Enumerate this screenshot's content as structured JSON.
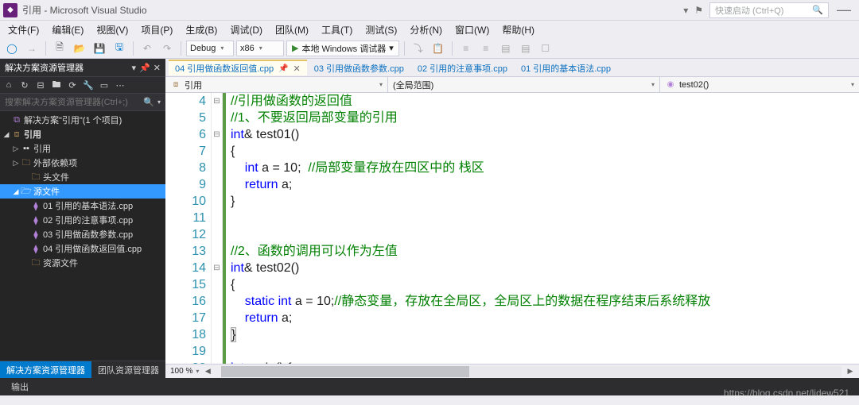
{
  "title": "引用 - Microsoft Visual Studio",
  "quicklaunch_placeholder": "快速启动 (Ctrl+Q)",
  "menu": [
    "文件(F)",
    "编辑(E)",
    "视图(V)",
    "项目(P)",
    "生成(B)",
    "调试(D)",
    "团队(M)",
    "工具(T)",
    "测试(S)",
    "分析(N)",
    "窗口(W)",
    "帮助(H)"
  ],
  "toolbar": {
    "config": "Debug",
    "platform": "x86",
    "run": "本地 Windows 调试器"
  },
  "sidepanel": {
    "title": "解决方案资源管理器",
    "search_placeholder": "搜索解决方案资源管理器(Ctrl+;)",
    "solution": "解决方案\"引用\"(1 个项目)",
    "project": "引用",
    "nodes": {
      "refs": "引用",
      "extdep": "外部依赖项",
      "headers": "头文件",
      "sources": "源文件",
      "resources": "资源文件"
    },
    "files": [
      "01 引用的基本语法.cpp",
      "02 引用的注意事项.cpp",
      "03 引用做函数参数.cpp",
      "04 引用做函数返回值.cpp"
    ],
    "tabs": [
      "解决方案资源管理器",
      "团队资源管理器"
    ]
  },
  "doctabs": [
    "04 引用做函数返回值.cpp",
    "03 引用做函数参数.cpp",
    "02 引用的注意事项.cpp",
    "01 引用的基本语法.cpp"
  ],
  "navbar": {
    "scope": "引用",
    "member": "(全局范围)",
    "func": "test02()"
  },
  "editor": {
    "first_line": 4,
    "zoom": "100 %",
    "lines": [
      {
        "tokens": [
          {
            "t": "//引用做函数的返回值",
            "c": "cm"
          }
        ],
        "fold": "-"
      },
      {
        "tokens": [
          {
            "t": "//1、不要返回局部变量的引用",
            "c": "cm"
          }
        ]
      },
      {
        "tokens": [
          {
            "t": "int",
            "c": "kw"
          },
          {
            "t": "& test01()"
          }
        ],
        "fold": "-"
      },
      {
        "tokens": [
          {
            "t": "{"
          }
        ]
      },
      {
        "tokens": [
          {
            "t": "    "
          },
          {
            "t": "int",
            "c": "kw"
          },
          {
            "t": " a = 10;  "
          },
          {
            "t": "//局部变量存放在四区中的 栈区",
            "c": "cm"
          }
        ]
      },
      {
        "tokens": [
          {
            "t": "    "
          },
          {
            "t": "return",
            "c": "kw"
          },
          {
            "t": " a;"
          }
        ]
      },
      {
        "tokens": [
          {
            "t": "}"
          }
        ]
      },
      {
        "tokens": [
          {
            "t": ""
          }
        ]
      },
      {
        "tokens": [
          {
            "t": ""
          }
        ]
      },
      {
        "tokens": [
          {
            "t": "//2、函数的调用可以作为左值",
            "c": "cm"
          }
        ]
      },
      {
        "tokens": [
          {
            "t": "int",
            "c": "kw"
          },
          {
            "t": "& test02()"
          }
        ],
        "fold": "-"
      },
      {
        "tokens": [
          {
            "t": "{"
          }
        ]
      },
      {
        "tokens": [
          {
            "t": "    "
          },
          {
            "t": "static",
            "c": "kw"
          },
          {
            "t": " "
          },
          {
            "t": "int",
            "c": "kw"
          },
          {
            "t": " a = 10;"
          },
          {
            "t": "//静态变量，存放在全局区，全局区上的数据在程序结束后系统释放",
            "c": "cm"
          }
        ]
      },
      {
        "tokens": [
          {
            "t": "    "
          },
          {
            "t": "return",
            "c": "kw"
          },
          {
            "t": " a;"
          }
        ]
      },
      {
        "tokens": [
          {
            "t": "}",
            "hl": true
          }
        ]
      },
      {
        "tokens": [
          {
            "t": ""
          }
        ]
      },
      {
        "tokens": [
          {
            "t": "int",
            "c": "kw"
          },
          {
            "t": " main() {"
          }
        ],
        "fold": "-"
      },
      {
        "tokens": [
          {
            "t": ""
          }
        ]
      }
    ]
  },
  "bottom": {
    "output": "输出"
  },
  "watermark": "https://blog.csdn.net/lidew521"
}
